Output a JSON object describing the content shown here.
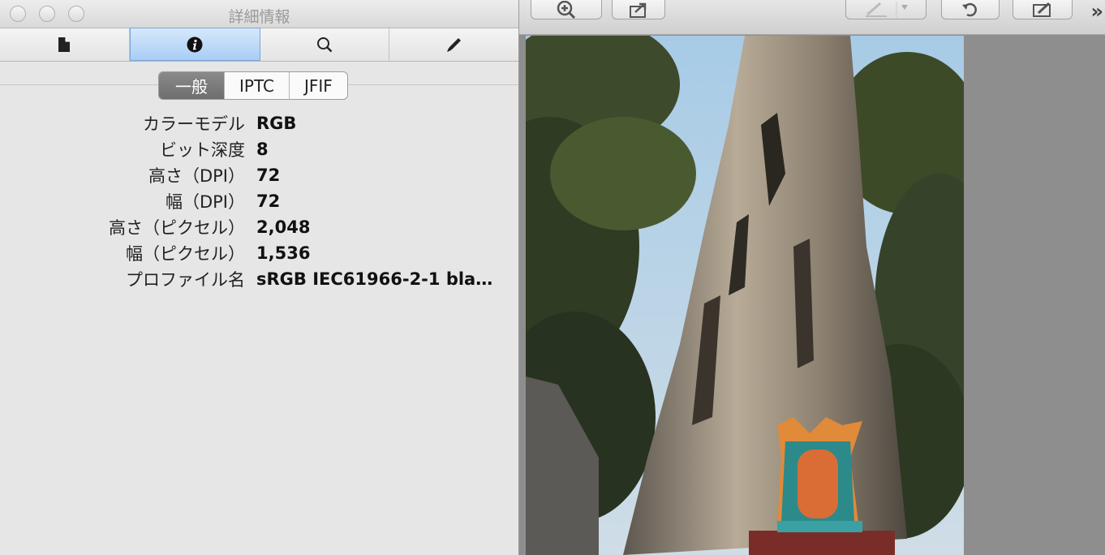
{
  "window": {
    "title": "詳細情報"
  },
  "tabs": [
    {
      "icon": "document-icon"
    },
    {
      "icon": "info-icon"
    },
    {
      "icon": "search-icon"
    },
    {
      "icon": "pen-icon"
    }
  ],
  "segments": [
    {
      "label": "一般",
      "active": true
    },
    {
      "label": "IPTC",
      "active": false
    },
    {
      "label": "JFIF",
      "active": false
    }
  ],
  "properties": [
    {
      "label": "カラーモデル",
      "value": "RGB"
    },
    {
      "label": "ビット深度",
      "value": "8"
    },
    {
      "label": "高さ（DPI）",
      "value": "72"
    },
    {
      "label": "幅（DPI）",
      "value": "72"
    },
    {
      "label": "高さ（ピクセル）",
      "value": "2,048"
    },
    {
      "label": "幅（ピクセル）",
      "value": "1,536"
    },
    {
      "label": "プロファイル名",
      "value": "sRGB IEC61966-2-1 bla…"
    }
  ],
  "app_toolbar": {
    "overflow_label": "»"
  },
  "colors": {
    "active_tab": "#a9cdf5",
    "segment_active": "#777777"
  }
}
